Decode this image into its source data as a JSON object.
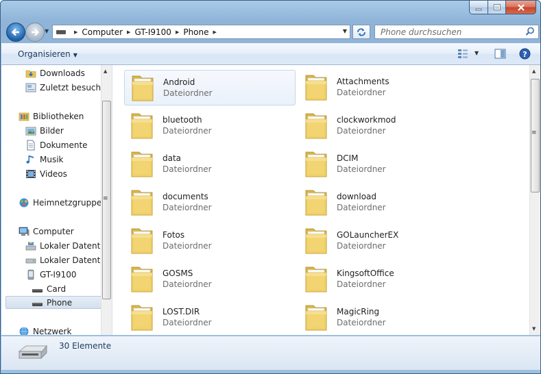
{
  "breadcrumb": [
    "Computer",
    "GT-I9100",
    "Phone"
  ],
  "search": {
    "placeholder": "Phone durchsuchen"
  },
  "toolbar": {
    "organize_label": "Organisieren"
  },
  "nav": {
    "items": [
      {
        "label": "Downloads",
        "icon": "downloads-folder-icon"
      },
      {
        "label": "Zuletzt besucht",
        "icon": "recent-places-icon"
      },
      {
        "label": "Bibliotheken",
        "icon": "libraries-icon"
      },
      {
        "label": "Bilder",
        "icon": "pictures-library-icon"
      },
      {
        "label": "Dokumente",
        "icon": "documents-library-icon"
      },
      {
        "label": "Musik",
        "icon": "music-library-icon"
      },
      {
        "label": "Videos",
        "icon": "videos-library-icon"
      },
      {
        "label": "Heimnetzgruppe",
        "icon": "homegroup-icon"
      },
      {
        "label": "Computer",
        "icon": "computer-icon"
      },
      {
        "label": "Lokaler Datenträger (C:)",
        "icon": "local-disk-icon"
      },
      {
        "label": "Lokaler Datenträger (D:)",
        "icon": "local-disk-icon"
      },
      {
        "label": "GT-I9100",
        "icon": "phone-device-icon"
      },
      {
        "label": "Card",
        "icon": "storage-drive-icon"
      },
      {
        "label": "Phone",
        "icon": "storage-drive-icon",
        "selected": true
      },
      {
        "label": "Netzwerk",
        "icon": "network-icon"
      }
    ]
  },
  "files": [
    {
      "name": "Android",
      "type": "Dateiordner",
      "selected": true
    },
    {
      "name": "Attachments",
      "type": "Dateiordner"
    },
    {
      "name": "bluetooth",
      "type": "Dateiordner"
    },
    {
      "name": "clockworkmod",
      "type": "Dateiordner"
    },
    {
      "name": "data",
      "type": "Dateiordner"
    },
    {
      "name": "DCIM",
      "type": "Dateiordner"
    },
    {
      "name": "documents",
      "type": "Dateiordner"
    },
    {
      "name": "download",
      "type": "Dateiordner"
    },
    {
      "name": "Fotos",
      "type": "Dateiordner"
    },
    {
      "name": "GOLauncherEX",
      "type": "Dateiordner"
    },
    {
      "name": "GOSMS",
      "type": "Dateiordner"
    },
    {
      "name": "KingsoftOffice",
      "type": "Dateiordner"
    },
    {
      "name": "LOST.DIR",
      "type": "Dateiordner"
    },
    {
      "name": "MagicRing",
      "type": "Dateiordner"
    }
  ],
  "status": {
    "item_count": "30 Elemente"
  },
  "colors": {
    "folder": "#f2d36b",
    "titlebar": "#9cc0e0",
    "selection": "#eaf1fa"
  }
}
